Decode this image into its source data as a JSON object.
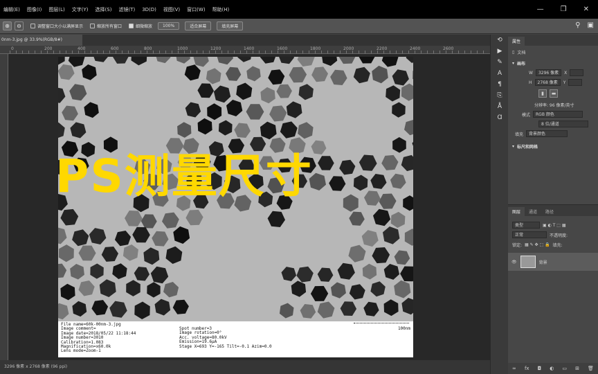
{
  "menu": [
    "编辑(E)",
    "图像(I)",
    "图层(L)",
    "文字(Y)",
    "选择(S)",
    "滤镜(T)",
    "3D(D)",
    "视图(V)",
    "窗口(W)",
    "帮助(H)"
  ],
  "window_controls": [
    "—",
    "❐",
    "✕"
  ],
  "options_bar": {
    "check_resize": "调整窗口大小以满屏显示",
    "check_zoom_all": "缩放所有窗口",
    "check_scrubby": "细微缩放",
    "zoom_value": "100%",
    "fit_screen": "适合屏幕",
    "fill_screen": "填充屏幕"
  },
  "document": {
    "tab": "0nm-3.jpg @ 33.9%(RGB/8#)",
    "status": "3296 像素 x 2768 像素 (96 ppi)"
  },
  "ruler_ticks": [
    "0",
    "50",
    "100",
    "150",
    "200",
    "250",
    "300",
    "350",
    "400",
    "450",
    "500",
    "550",
    "600",
    "650",
    "700",
    "750",
    "800",
    "850",
    "900",
    "950",
    "1000",
    "1050",
    "1100",
    "1150",
    "1200",
    "1250",
    "1300",
    "1350",
    "1400",
    "1450",
    "1500",
    "1550",
    "1600",
    "1650",
    "1700",
    "1750",
    "1800",
    "1850",
    "1900",
    "1950",
    "2000",
    "2050",
    "2100",
    "2150",
    "2200",
    "2250",
    "2300",
    "2350",
    "2400",
    "2450",
    "2500",
    "2550",
    "2600",
    "2650",
    "2700",
    "2750",
    "2800",
    "2850",
    "2900",
    "2950",
    "3000",
    "3050",
    "3100",
    "3150",
    "3200",
    "3250",
    "3300",
    "3350",
    "3400",
    "3450",
    "3500",
    "3550",
    "3600",
    "3650",
    "3700",
    "3750",
    "3800"
  ],
  "overlay_title": "PS测量尺寸",
  "sem_info": {
    "left": [
      "File name=60k-00nm-3.jpg",
      "Image comment=",
      "Image date=2018/05/22 11:18:44",
      "Image number=3010",
      "Calibration=1.083",
      "Magnification=x60.0k",
      "Lens mode=Zoom-1"
    ],
    "right": [
      "Spot number=3",
      "Image rotation=0°",
      "Acc. voltage=80.0kV",
      "Emission=19.6µA",
      "Stage X=693 Y=-165 Tilt=-0.1 Azim=0.0"
    ],
    "scale": "100nm"
  },
  "properties_panel": {
    "tab_active": "属性",
    "doc_label": "文档",
    "canvas_section": "画布",
    "w_label": "W",
    "w_value": "3296 像素",
    "h_label": "H",
    "h_value": "2768 像素",
    "x_label": "X",
    "y_label": "Y",
    "resolution": "分辨率: 96 像素/英寸",
    "mode_label": "模式",
    "mode_value": "RGB 颜色",
    "depth_value": "8 位/通道",
    "fill_label": "填充",
    "fill_value": "背景颜色",
    "rulers_section": "标尺和网格"
  },
  "layers_panel": {
    "tabs": [
      "图层",
      "通道",
      "路径"
    ],
    "filter": "类型",
    "blend": "正常",
    "opacity_label": "不透明度:",
    "lock_label": "锁定:",
    "fill_label": "填充:",
    "layer_name": "背景"
  },
  "colors": {
    "overlay": "#ffd800",
    "app_bg": "#434343",
    "canvas_bg": "#282828"
  }
}
